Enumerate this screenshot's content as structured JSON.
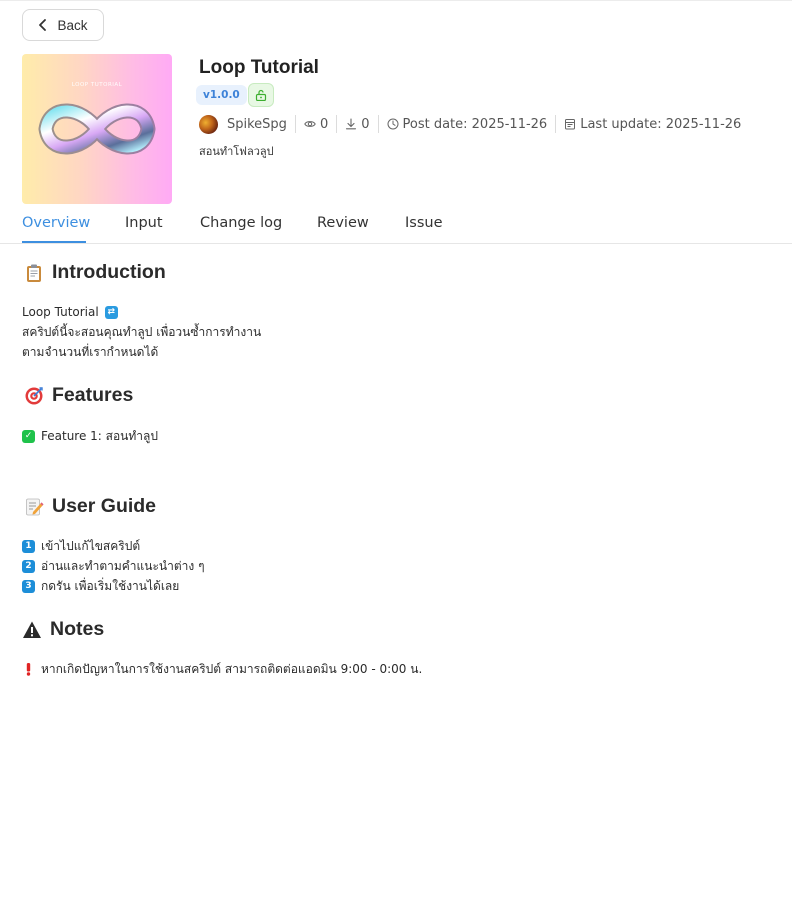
{
  "nav": {
    "back_label": "Back"
  },
  "thumbnail": {
    "caption": "LOOP TUTORIAL"
  },
  "header": {
    "title": "Loop Tutorial",
    "version": "v1.0.0",
    "author": "SpikeSpg",
    "views": "0",
    "downloads": "0",
    "post_date": "Post date: 2025-11-26",
    "last_update": "Last update: 2025-11-26",
    "description": "สอนทำโฟลวลูป"
  },
  "tabs": [
    "Overview",
    "Input",
    "Change log",
    "Review",
    "Issue"
  ],
  "content": {
    "introduction": {
      "heading": "Introduction",
      "name_line": "Loop Tutorial",
      "lines": [
        "สคริปต์นี้จะสอนคุณทำลูป เพื่อวนซ้ำการทำงาน",
        "ตามจำนวนที่เรากำหนดได้"
      ]
    },
    "features": {
      "heading": "Features",
      "items": [
        "Feature 1: สอนทำลูป"
      ]
    },
    "guide": {
      "heading": "User Guide",
      "steps": [
        {
          "num": "1",
          "text": "เข้าไปแก้ไขสคริปต์"
        },
        {
          "num": "2",
          "text": "อ่านและทำตามคำแนะนำต่าง ๆ"
        },
        {
          "num": "3",
          "text": "กดรัน เพื่อเริ่มใช้งานได้เลย"
        }
      ]
    },
    "notes": {
      "heading": "Notes",
      "items": [
        "หากเกิดปัญหาในการใช้งานสคริปต์ สามารถติดต่อแอดมิน 9:00 - 0:00 น."
      ]
    }
  },
  "colors": {
    "accent": "#3d8fe0",
    "version_badge_bg": "#e8f1fd",
    "lock_badge_bg": "#e8f8e4"
  },
  "icons": [
    "chevron-left-icon",
    "unlock-icon",
    "eye-icon",
    "download-icon",
    "clock-icon",
    "calendar-icon",
    "clipboard-icon",
    "target-icon",
    "memo-icon",
    "warning-icon",
    "exclamation-icon",
    "check-icon",
    "repeat-icon"
  ]
}
